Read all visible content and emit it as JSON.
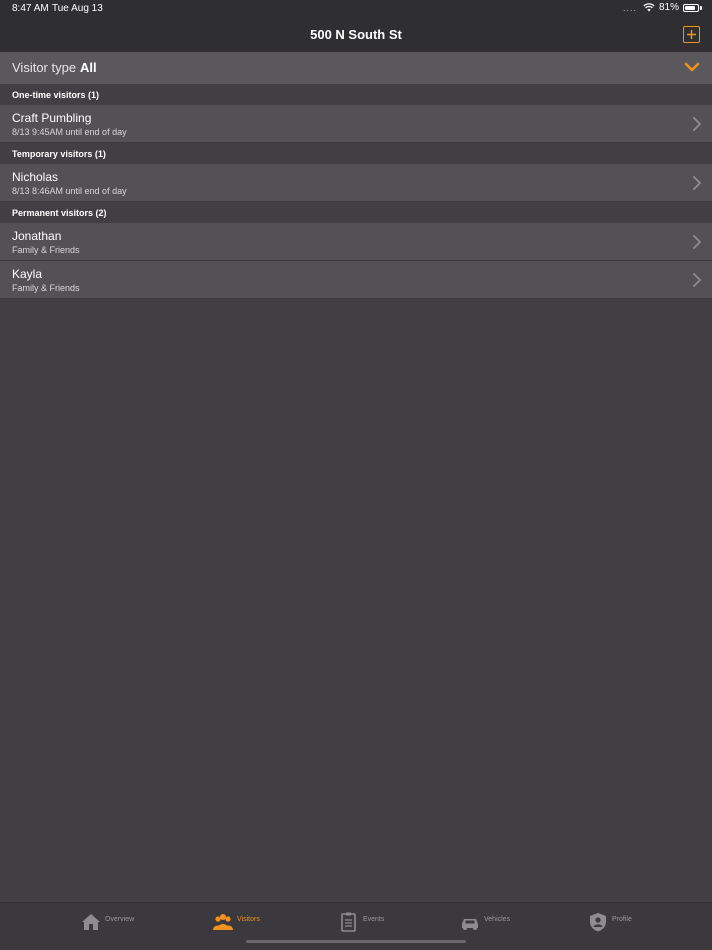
{
  "status_bar": {
    "time": "8:47 AM",
    "date": "Tue Aug 13",
    "signal_dots": "....",
    "battery": "81%",
    "battery_level": 0.81
  },
  "nav": {
    "title": "500 N South St",
    "add_icon": "plus-square-icon"
  },
  "filter": {
    "label": "Visitor type",
    "value": "All",
    "icon": "chevron-down-icon"
  },
  "sections": [
    {
      "header": "One-time visitors (1)",
      "rows": [
        {
          "title": "Craft Pumbling",
          "subtitle": "8/13 9:45AM until end of day"
        }
      ]
    },
    {
      "header": "Temporary visitors (1)",
      "rows": [
        {
          "title": "Nicholas",
          "subtitle": "8/13 8:46AM until end of day"
        }
      ]
    },
    {
      "header": "Permanent visitors (2)",
      "rows": [
        {
          "title": "Jonathan",
          "subtitle": "Family & Friends"
        },
        {
          "title": "Kayla",
          "subtitle": "Family & Friends"
        }
      ]
    }
  ],
  "tabs": [
    {
      "label": "Overview",
      "icon": "house-icon",
      "active": false
    },
    {
      "label": "Visitors",
      "icon": "people-icon",
      "active": true
    },
    {
      "label": "Events",
      "icon": "clipboard-icon",
      "active": false
    },
    {
      "label": "Vehicles",
      "icon": "car-icon",
      "active": false
    },
    {
      "label": "Profile",
      "icon": "shield-user-icon",
      "active": false
    }
  ],
  "colors": {
    "accent": "#f2921f",
    "background": "#413f43",
    "row": "#535155",
    "bar": "#2f2e31"
  }
}
